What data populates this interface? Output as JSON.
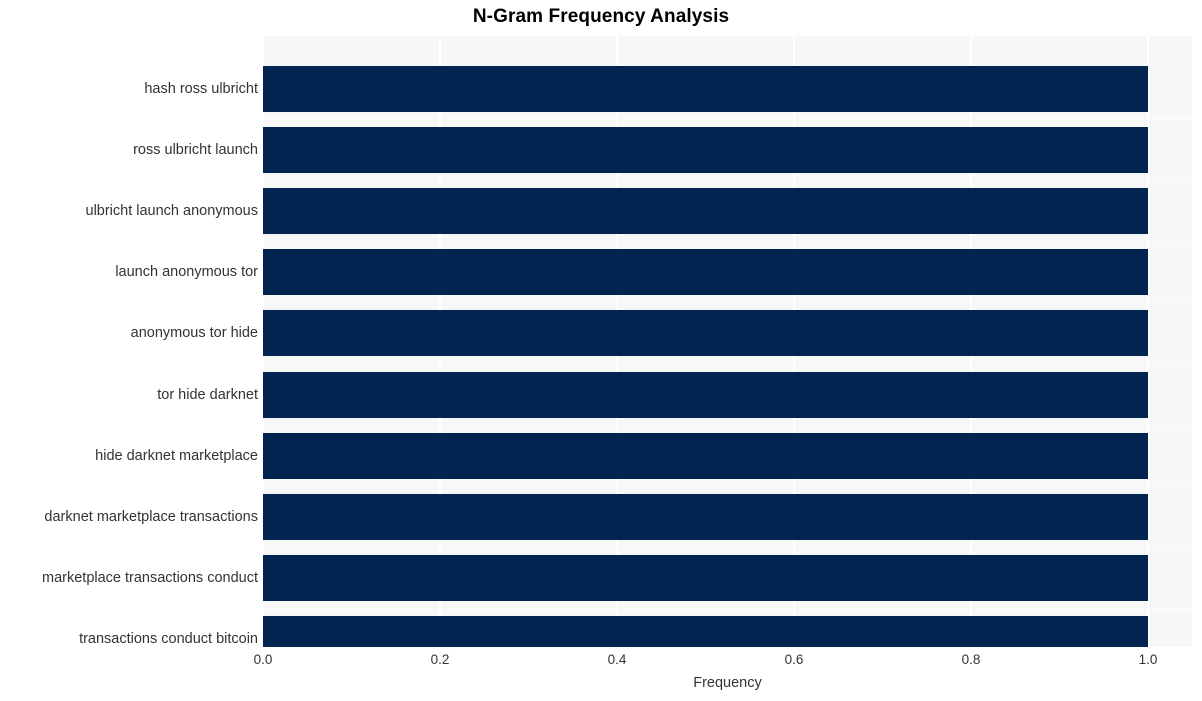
{
  "chart_data": {
    "type": "bar",
    "orientation": "horizontal",
    "title": "N-Gram Frequency Analysis",
    "xlabel": "Frequency",
    "ylabel": "",
    "xlim": [
      0.0,
      1.0
    ],
    "xticks": [
      "0.0",
      "0.2",
      "0.4",
      "0.6",
      "0.8",
      "1.0"
    ],
    "xtick_values": [
      0.0,
      0.2,
      0.4,
      0.6,
      0.8,
      1.0
    ],
    "grid": true,
    "legend": "none",
    "bar_color": "#022450",
    "plot_background": "#f7f7f7",
    "figure_background": "#ffffff",
    "categories": [
      "hash ross ulbricht",
      "ross ulbricht launch",
      "ulbricht launch anonymous",
      "launch anonymous tor",
      "anonymous tor hide",
      "tor hide darknet",
      "hide darknet marketplace",
      "darknet marketplace transactions",
      "marketplace transactions conduct",
      "transactions conduct bitcoin"
    ],
    "values": [
      1.0,
      1.0,
      1.0,
      1.0,
      1.0,
      1.0,
      1.0,
      1.0,
      1.0,
      1.0
    ]
  }
}
